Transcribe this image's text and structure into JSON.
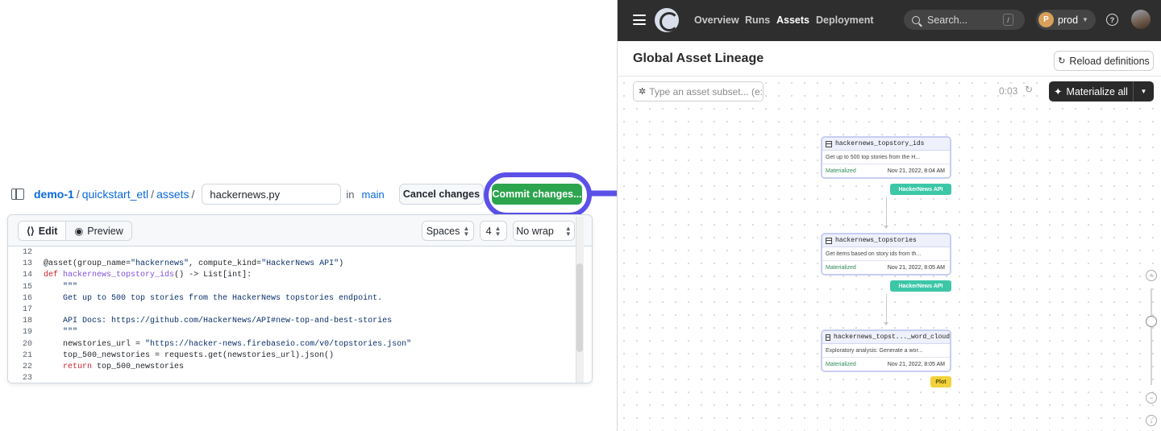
{
  "github": {
    "repo": "demo-1",
    "path": [
      "quickstart_etl",
      "assets"
    ],
    "separator": "/",
    "filename": "hackernews.py",
    "in_label": "in",
    "branch": "main",
    "cancel_label": "Cancel changes",
    "commit_label": "Commit changes...",
    "edit_tab": "Edit",
    "preview_tab": "Preview",
    "indent_mode": "Spaces",
    "indent_size": "4",
    "wrap_mode": "No wrap",
    "code_lines": [
      {
        "n": "12",
        "html": ""
      },
      {
        "n": "13",
        "html": "@asset(group_name=<span class='str'>\"hackernews\"</span>, compute_kind=<span class='str'>\"HackerNews API\"</span>)"
      },
      {
        "n": "14",
        "html": "<span class='kw'>def</span> <span class='fn'>hackernews_topstory_ids</span>() -&gt; List[int]:"
      },
      {
        "n": "15",
        "html": "    <span class='str'>\"\"\"</span>"
      },
      {
        "n": "16",
        "html": "<span class='str'>    Get up to 500 top stories from the HackerNews topstories endpoint.</span>"
      },
      {
        "n": "17",
        "html": ""
      },
      {
        "n": "18",
        "html": "<span class='str'>    API Docs: https://github.com/HackerNews/API#new-top-and-best-stories</span>"
      },
      {
        "n": "19",
        "html": "    <span class='str'>\"\"\"</span>"
      },
      {
        "n": "20",
        "html": "    newstories_url = <span class='str'>\"https://hacker-news.firebaseio.com/v0/topstories.json\"</span>"
      },
      {
        "n": "21",
        "html": "    top_500_newstories = requests.get(newstories_url).json()"
      },
      {
        "n": "22",
        "html": "    <span class='kw'>return</span> top_500_newstories"
      },
      {
        "n": "23",
        "html": ""
      }
    ]
  },
  "dagster": {
    "nav": [
      "Overview",
      "Runs",
      "Assets",
      "Deployment"
    ],
    "active_nav": "Assets",
    "search_placeholder": "Search...",
    "search_shortcut": "/",
    "deployment": "prod",
    "deployment_initial": "P",
    "help_glyph": "?",
    "page_title": "Global Asset Lineage",
    "reload_label": "Reload definitions",
    "subset_placeholder": "Type an asset subset... (e:",
    "timer": "0:03",
    "materialize_label": "Materialize all",
    "nodes": [
      {
        "name": "hackernews_topstory_ids",
        "desc": "Get up to 500 top stories from the H...",
        "status": "Materialized",
        "time": "Nov 21, 2022, 8:04 AM",
        "tag": "HackerNews API",
        "tag_kind": "api"
      },
      {
        "name": "hackernews_topstories",
        "desc": "Get items based on story ids from th...",
        "status": "Materialized",
        "time": "Nov 21, 2022, 8:05 AM",
        "tag": "HackerNews API",
        "tag_kind": "api"
      },
      {
        "name": "hackernews_topst..._word_cloud",
        "desc": "Exploratory analysis: Generate a wor...",
        "status": "Materialized",
        "time": "Nov 21, 2022, 8:05 AM",
        "tag": "Plot",
        "tag_kind": "plot"
      }
    ]
  },
  "colors": {
    "commit_green": "#2da44e",
    "highlight_ring": "#5b50e8",
    "dagster_topbar": "#2e2e2e",
    "link_blue": "#0969da",
    "tag_api": "#3cc7a8",
    "tag_plot": "#f1d23b"
  }
}
